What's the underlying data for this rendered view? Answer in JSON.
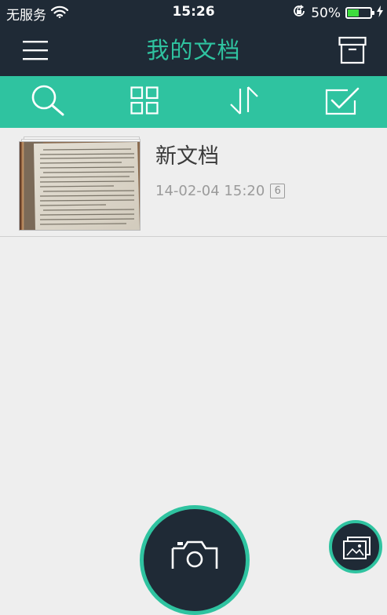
{
  "status_bar": {
    "carrier": "无服务",
    "time": "15:26",
    "battery_percent": "50%",
    "battery_level": 0.5,
    "icons": [
      "wifi-icon",
      "rotation-lock-icon",
      "battery-icon",
      "charging-bolt-icon"
    ]
  },
  "nav": {
    "title": "我的文档",
    "left_icon": "menu-icon",
    "right_icon": "archive-box-icon"
  },
  "toolbar": {
    "items": [
      {
        "icon": "search-icon"
      },
      {
        "icon": "grid-view-icon"
      },
      {
        "icon": "sort-icon"
      },
      {
        "icon": "select-checkbox-icon"
      }
    ]
  },
  "documents": [
    {
      "name": "新文档",
      "date": "14-02-04 15:20",
      "page_count": "6",
      "thumbnail_icon": "document-thumbnail"
    }
  ],
  "bottom": {
    "camera_icon": "camera-icon",
    "gallery_icon": "gallery-import-icon"
  },
  "colors": {
    "header_dark": "#1f2a36",
    "accent_green": "#2fc3a0",
    "background": "#eeeeee",
    "battery_green": "#3ddc3d",
    "text_dark": "#3a3a3a",
    "text_grey": "#9b9b9b"
  }
}
